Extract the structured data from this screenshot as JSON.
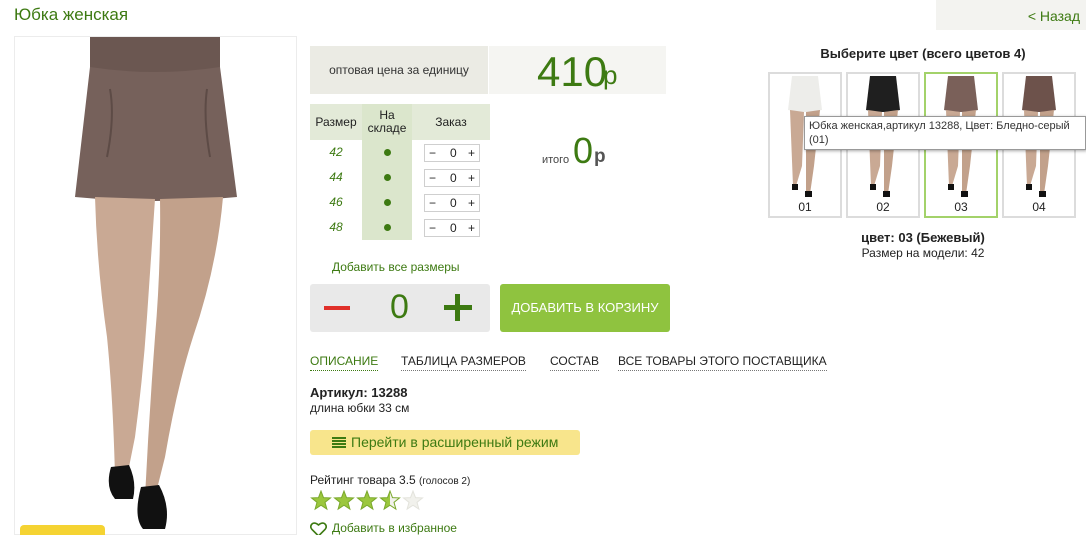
{
  "header": {
    "title": "Юбка женская",
    "back_link": "< Назад"
  },
  "price": {
    "label": "оптовая цена за единицу",
    "value": "410",
    "currency": "р"
  },
  "size_table": {
    "headers": {
      "size": "Размер",
      "stock": "На складе",
      "order": "Заказ"
    },
    "rows": [
      {
        "size": "42",
        "in_stock": true,
        "qty": "0"
      },
      {
        "size": "44",
        "in_stock": true,
        "qty": "0"
      },
      {
        "size": "46",
        "in_stock": true,
        "qty": "0"
      },
      {
        "size": "48",
        "in_stock": true,
        "qty": "0"
      }
    ]
  },
  "total": {
    "label": "итого",
    "value": "0",
    "currency": "р"
  },
  "add_all_sizes": "Добавить все размеры",
  "quantity": {
    "value": "0"
  },
  "cart_button": "ДОБАВИТЬ В КОРЗИНУ",
  "tabs": [
    {
      "label": "ОПИСАНИЕ",
      "active": true
    },
    {
      "label": "ТАБЛИЦА РАЗМЕРОВ",
      "active": false
    },
    {
      "label": "СОСТАВ",
      "active": false
    },
    {
      "label": "ВСЕ ТОВАРЫ ЭТОГО ПОСТАВЩИКА",
      "active": false
    }
  ],
  "description": {
    "article": "Артикул: 13288",
    "details": "длина юбки 33 см"
  },
  "advanced_mode": "Перейти в расширенный режим",
  "rating": {
    "text": "Рейтинг товара 3.5",
    "votes": "(голосов 2)",
    "value": 3.5,
    "max": 5
  },
  "favorites": "Добавить в избранное",
  "color_chooser": {
    "title": "Выберите цвет (всего цветов 4)",
    "swatches": [
      {
        "label": "01",
        "color": "#ededea",
        "selected": false
      },
      {
        "label": "02",
        "color": "#1f1f1f",
        "selected": false
      },
      {
        "label": "03",
        "color": "#7a6059",
        "selected": true
      },
      {
        "label": "04",
        "color": "#6d524b",
        "selected": false
      }
    ],
    "tooltip": "Юбка женская,артикул 13288, Цвет: Бледно-серый (01)",
    "selected_color": "цвет: 03 (Бежевый)",
    "model_size": "Размер на модели: 42"
  },
  "colors": {
    "accent_green": "#3d7a12",
    "button_green": "#8fc33f",
    "minus_red": "#e0302a",
    "yellow": "#f8e58c",
    "skirt": "#76615b"
  }
}
